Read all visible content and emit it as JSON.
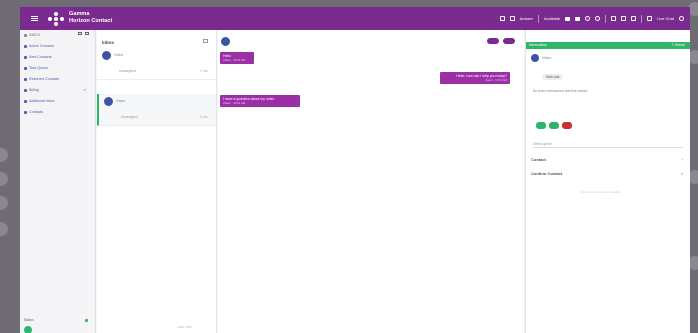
{
  "app": {
    "brand_line1": "Gamma",
    "brand_line2": "Horizon Contact",
    "colors": {
      "primary": "#7b2b8f",
      "accent": "#2fb56a",
      "link": "#4a5fb0",
      "bubble": "#9b2fa5"
    }
  },
  "topbar": {
    "help_label": "Answer",
    "status_label": "Available",
    "user_label": "Live Chat"
  },
  "sidebar": {
    "items": [
      {
        "label": "INBOX",
        "icon": "inbox-icon"
      },
      {
        "label": "Active Contacts",
        "icon": "contacts-icon"
      },
      {
        "label": "Sent Contacts",
        "icon": "sent-icon"
      },
      {
        "label": "Task Queue",
        "icon": "queue-icon"
      },
      {
        "label": "Resolved Contacts",
        "icon": "resolved-icon"
      },
      {
        "label": "Billing",
        "icon": "billing-icon"
      },
      {
        "label": "Additional Inbox",
        "icon": "inbox2-icon"
      },
      {
        "label": "Contacts",
        "icon": "person-icon"
      }
    ],
    "bottom_label": "Status"
  },
  "inbox": {
    "title": "Inbox",
    "conversations": [
      {
        "name": "Visitor",
        "tag": "Unassigned",
        "time": "2 min"
      },
      {
        "name": "Visitor",
        "tag": "Unassigned",
        "time": "5 min"
      }
    ],
    "footer": "Load more"
  },
  "chat": {
    "messages": [
      {
        "text": "Hello",
        "sub": "Visitor · 10:14 AM"
      },
      {
        "text": "Hello, how can I help you today?",
        "sub": "Agent · 10:15 AM"
      },
      {
        "text": "I have a question about my order",
        "sub": "Visitor · 10:16 AM"
      }
    ]
  },
  "details": {
    "header": "Information",
    "header_right": "7 Online",
    "name": "Visitor",
    "chip": "Web chat",
    "note": "No recent interactions with this contact",
    "select_placeholder": "Select queue",
    "rows": [
      {
        "label": "Contact",
        "icon": "chevron-icon"
      },
      {
        "label": "Confirm Contact",
        "icon": "search-icon"
      }
    ],
    "faint": "No more information available"
  }
}
